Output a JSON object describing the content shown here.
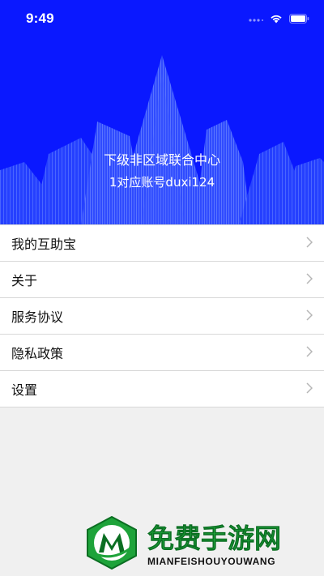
{
  "status_bar": {
    "time": "9:49",
    "icons": [
      "signal-dots-icon",
      "wifi-icon",
      "battery-icon"
    ]
  },
  "header": {
    "organization": "下级非区域联合中心",
    "account": "1对应账号duxi124",
    "background_color": "#0a18ff"
  },
  "menu": {
    "items": [
      {
        "label": "我的互助宝",
        "icon": "chevron-right-icon"
      },
      {
        "label": "关于",
        "icon": "chevron-right-icon"
      },
      {
        "label": "服务协议",
        "icon": "chevron-right-icon"
      },
      {
        "label": "隐私政策",
        "icon": "chevron-right-icon"
      },
      {
        "label": "设置",
        "icon": "chevron-right-icon"
      }
    ]
  },
  "watermark": {
    "title": "免费手游网",
    "subtitle": "MIANFEISHOUYOUWANG",
    "brand_color": "#1ea33a"
  }
}
